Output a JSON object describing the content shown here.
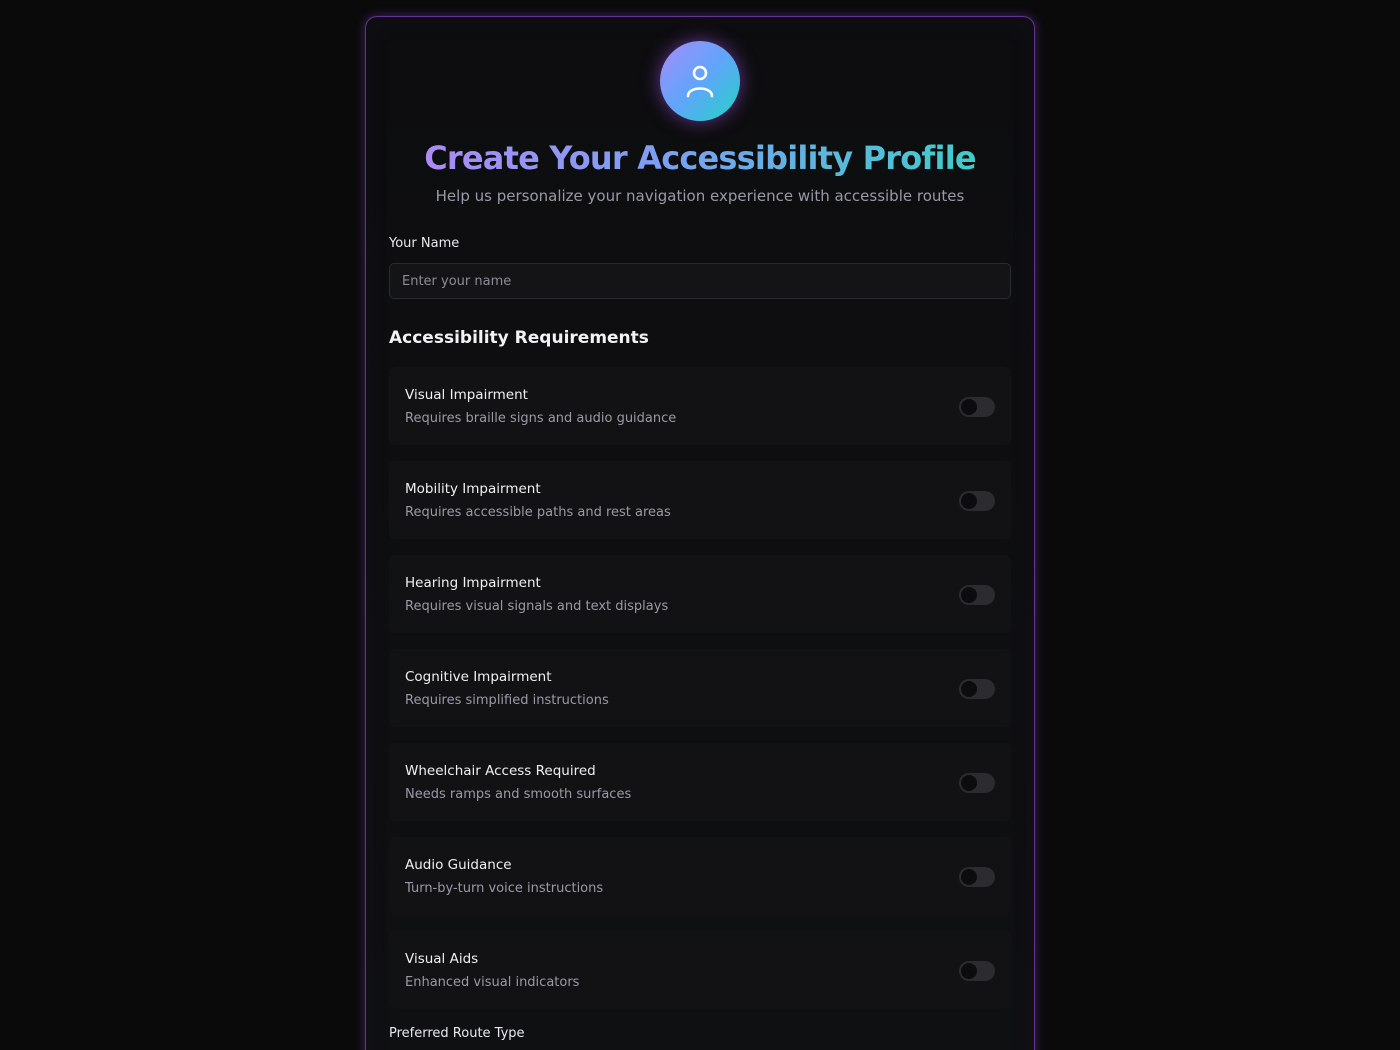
{
  "header": {
    "avatar_icon": "user-icon",
    "title": "Create Your Accessibility Profile",
    "subtitle": "Help us personalize your navigation experience with accessible routes"
  },
  "name_field": {
    "label": "Your Name",
    "placeholder": "Enter your name",
    "value": ""
  },
  "requirements": {
    "title": "Accessibility Requirements",
    "items": [
      {
        "title": "Visual Impairment",
        "description": "Requires braille signs and audio guidance",
        "enabled": false
      },
      {
        "title": "Mobility Impairment",
        "description": "Requires accessible paths and rest areas",
        "enabled": false
      },
      {
        "title": "Hearing Impairment",
        "description": "Requires visual signals and text displays",
        "enabled": false
      },
      {
        "title": "Cognitive Impairment",
        "description": "Requires simplified instructions",
        "enabled": false
      },
      {
        "title": "Wheelchair Access Required",
        "description": "Needs ramps and smooth surfaces",
        "enabled": false
      },
      {
        "title": "Audio Guidance",
        "description": "Turn-by-turn voice instructions",
        "enabled": false
      },
      {
        "title": "Visual Aids",
        "description": "Enhanced visual indicators",
        "enabled": false
      }
    ]
  },
  "route": {
    "label": "Preferred Route Type"
  },
  "colors": {
    "accent_purple": "#a855f7",
    "accent_teal": "#22d3c5",
    "background": "#0a0a0b"
  }
}
